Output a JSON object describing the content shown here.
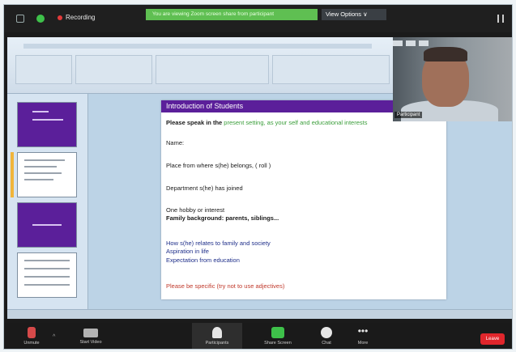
{
  "top_bar": {
    "recording_label": "Recording",
    "share_banner_text": "You are viewing Zoom screen share from participant",
    "view_options_label": "View Options ∨"
  },
  "slide": {
    "title": "Introduction of Students",
    "line1_prefix": "Please speak  in the",
    "line1_suffix": "present setting, as your self and educational interests",
    "name": "Name:",
    "place": "Place from where s(he) belongs, ( roll )",
    "department": "Department s(he) has joined",
    "hobby": "One hobby or interest",
    "family": "Family background: parents, siblings...",
    "relates": "How s(he) relates to family and society",
    "aspiration": "Aspiration in life",
    "expectation": "Expectation from education",
    "note": "Please be specific (try not to use adjectives)"
  },
  "video": {
    "participant_name": "Participant"
  },
  "toolbar": {
    "mute_label": "Unmute",
    "video_label": "Start Video",
    "participants_label": "Participants",
    "share_label": "Share Screen",
    "chat_label": "Chat",
    "more_label": "More",
    "more_glyph": "•••",
    "leave_label": "Leave",
    "caret_glyph": "^"
  },
  "colors": {
    "slide_accent": "#5b1f9a",
    "share_banner": "#5fbf52",
    "leave": "#e0262c",
    "recording_dot": "#e23a3a"
  }
}
